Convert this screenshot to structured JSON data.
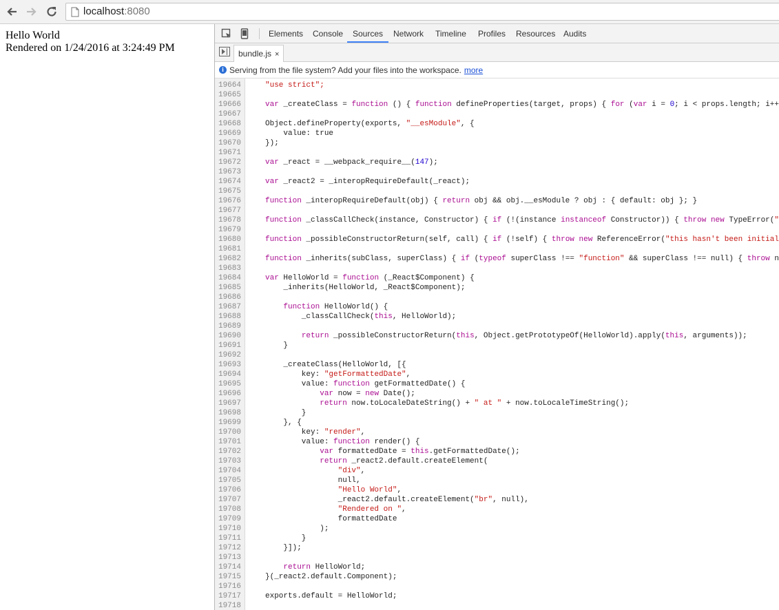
{
  "browser": {
    "url_host": "localhost",
    "url_port": ":8080"
  },
  "page": {
    "line1": "Hello World",
    "line2": "Rendered on 1/24/2016 at 3:24:49 PM"
  },
  "devtools": {
    "tabs": [
      "Elements",
      "Console",
      "Sources",
      "Network",
      "Timeline",
      "Profiles",
      "Resources",
      "Audits"
    ],
    "active_tab": "Sources",
    "file_tab": "bundle.js",
    "file_tab_close": "×",
    "info_icon": "i",
    "info_message": "Serving from the file system? Add your files into the workspace.",
    "info_link": "more"
  },
  "code_lines": [
    {
      "n": "19664",
      "t": [
        [
          "\"use strict\";",
          "str"
        ]
      ]
    },
    {
      "n": "19665",
      "t": []
    },
    {
      "n": "19666",
      "t": [
        [
          "var",
          "kw"
        ],
        [
          " _createClass = ",
          ""
        ],
        [
          "function",
          "kw"
        ],
        [
          " () { ",
          ""
        ],
        [
          "function",
          "kw"
        ],
        [
          " defineProperties(target, props) { ",
          ""
        ],
        [
          "for",
          "kw"
        ],
        [
          " (",
          ""
        ],
        [
          "var",
          "kw"
        ],
        [
          " i = ",
          ""
        ],
        [
          "0",
          "num"
        ],
        [
          "; i < props.length; i++",
          ""
        ]
      ]
    },
    {
      "n": "19667",
      "t": []
    },
    {
      "n": "19668",
      "t": [
        [
          "Object.defineProperty(exports, ",
          ""
        ],
        [
          "\"__esModule\"",
          "str"
        ],
        [
          ", {",
          ""
        ]
      ]
    },
    {
      "n": "19669",
      "t": [
        [
          "    value: true",
          ""
        ]
      ]
    },
    {
      "n": "19670",
      "t": [
        [
          "});",
          ""
        ]
      ]
    },
    {
      "n": "19671",
      "t": []
    },
    {
      "n": "19672",
      "t": [
        [
          "var",
          "kw"
        ],
        [
          " _react = __webpack_require__(",
          ""
        ],
        [
          "147",
          "num"
        ],
        [
          ");",
          ""
        ]
      ]
    },
    {
      "n": "19673",
      "t": []
    },
    {
      "n": "19674",
      "t": [
        [
          "var",
          "kw"
        ],
        [
          " _react2 = _interopRequireDefault(_react);",
          ""
        ]
      ]
    },
    {
      "n": "19675",
      "t": []
    },
    {
      "n": "19676",
      "t": [
        [
          "function",
          "kw"
        ],
        [
          " _interopRequireDefault(obj) { ",
          ""
        ],
        [
          "return",
          "kw"
        ],
        [
          " obj && obj.__esModule ? obj : { default: obj }; }",
          ""
        ]
      ]
    },
    {
      "n": "19677",
      "t": []
    },
    {
      "n": "19678",
      "t": [
        [
          "function",
          "kw"
        ],
        [
          " _classCallCheck(instance, Constructor) { ",
          ""
        ],
        [
          "if",
          "kw"
        ],
        [
          " (!(instance ",
          ""
        ],
        [
          "instanceof",
          "kw"
        ],
        [
          " Constructor)) { ",
          ""
        ],
        [
          "throw",
          "kw"
        ],
        [
          " ",
          ""
        ],
        [
          "new",
          "kw"
        ],
        [
          " TypeError(",
          ""
        ],
        [
          "\"C",
          "str"
        ]
      ]
    },
    {
      "n": "19679",
      "t": []
    },
    {
      "n": "19680",
      "t": [
        [
          "function",
          "kw"
        ],
        [
          " _possibleConstructorReturn(self, call) { ",
          ""
        ],
        [
          "if",
          "kw"
        ],
        [
          " (!self) { ",
          ""
        ],
        [
          "throw",
          "kw"
        ],
        [
          " ",
          ""
        ],
        [
          "new",
          "kw"
        ],
        [
          " ReferenceError(",
          ""
        ],
        [
          "\"this hasn't been initial",
          "str"
        ]
      ]
    },
    {
      "n": "19681",
      "t": []
    },
    {
      "n": "19682",
      "t": [
        [
          "function",
          "kw"
        ],
        [
          " _inherits(subClass, superClass) { ",
          ""
        ],
        [
          "if",
          "kw"
        ],
        [
          " (",
          ""
        ],
        [
          "typeof",
          "kw"
        ],
        [
          " superClass !== ",
          ""
        ],
        [
          "\"function\"",
          "str"
        ],
        [
          " && superClass !== null) { ",
          ""
        ],
        [
          "throw",
          "kw"
        ],
        [
          " ne",
          ""
        ]
      ]
    },
    {
      "n": "19683",
      "t": []
    },
    {
      "n": "19684",
      "t": [
        [
          "var",
          "kw"
        ],
        [
          " HelloWorld = ",
          ""
        ],
        [
          "function",
          "kw"
        ],
        [
          " (_React$Component) {",
          ""
        ]
      ]
    },
    {
      "n": "19685",
      "t": [
        [
          "    _inherits(HelloWorld, _React$Component);",
          ""
        ]
      ]
    },
    {
      "n": "19686",
      "t": []
    },
    {
      "n": "19687",
      "t": [
        [
          "    ",
          ""
        ],
        [
          "function",
          "kw"
        ],
        [
          " HelloWorld() {",
          ""
        ]
      ]
    },
    {
      "n": "19688",
      "t": [
        [
          "        _classCallCheck(",
          ""
        ],
        [
          "this",
          "kw"
        ],
        [
          ", HelloWorld);",
          ""
        ]
      ]
    },
    {
      "n": "19689",
      "t": []
    },
    {
      "n": "19690",
      "t": [
        [
          "        ",
          ""
        ],
        [
          "return",
          "kw"
        ],
        [
          " _possibleConstructorReturn(",
          ""
        ],
        [
          "this",
          "kw"
        ],
        [
          ", Object.getPrototypeOf(HelloWorld).apply(",
          ""
        ],
        [
          "this",
          "kw"
        ],
        [
          ", arguments));",
          ""
        ]
      ]
    },
    {
      "n": "19691",
      "t": [
        [
          "    }",
          ""
        ]
      ]
    },
    {
      "n": "19692",
      "t": []
    },
    {
      "n": "19693",
      "t": [
        [
          "    _createClass(HelloWorld, [{",
          ""
        ]
      ]
    },
    {
      "n": "19694",
      "t": [
        [
          "        key: ",
          ""
        ],
        [
          "\"getFormattedDate\"",
          "str"
        ],
        [
          ",",
          ""
        ]
      ]
    },
    {
      "n": "19695",
      "t": [
        [
          "        value: ",
          ""
        ],
        [
          "function",
          "kw"
        ],
        [
          " getFormattedDate() {",
          ""
        ]
      ]
    },
    {
      "n": "19696",
      "t": [
        [
          "            ",
          ""
        ],
        [
          "var",
          "kw"
        ],
        [
          " now = ",
          ""
        ],
        [
          "new",
          "kw"
        ],
        [
          " Date();",
          ""
        ]
      ]
    },
    {
      "n": "19697",
      "t": [
        [
          "            ",
          ""
        ],
        [
          "return",
          "kw"
        ],
        [
          " now.toLocaleDateString() + ",
          ""
        ],
        [
          "\" at \"",
          "str"
        ],
        [
          " + now.toLocaleTimeString();",
          ""
        ]
      ]
    },
    {
      "n": "19698",
      "t": [
        [
          "        }",
          ""
        ]
      ]
    },
    {
      "n": "19699",
      "t": [
        [
          "    }, {",
          ""
        ]
      ]
    },
    {
      "n": "19700",
      "t": [
        [
          "        key: ",
          ""
        ],
        [
          "\"render\"",
          "str"
        ],
        [
          ",",
          ""
        ]
      ]
    },
    {
      "n": "19701",
      "t": [
        [
          "        value: ",
          ""
        ],
        [
          "function",
          "kw"
        ],
        [
          " render() {",
          ""
        ]
      ]
    },
    {
      "n": "19702",
      "t": [
        [
          "            ",
          ""
        ],
        [
          "var",
          "kw"
        ],
        [
          " formattedDate = ",
          ""
        ],
        [
          "this",
          "kw"
        ],
        [
          ".getFormattedDate();",
          ""
        ]
      ]
    },
    {
      "n": "19703",
      "t": [
        [
          "            ",
          ""
        ],
        [
          "return",
          "kw"
        ],
        [
          " _react2.default.createElement(",
          ""
        ]
      ]
    },
    {
      "n": "19704",
      "t": [
        [
          "                ",
          ""
        ],
        [
          "\"div\"",
          "str"
        ],
        [
          ",",
          ""
        ]
      ]
    },
    {
      "n": "19705",
      "t": [
        [
          "                null,",
          ""
        ]
      ]
    },
    {
      "n": "19706",
      "t": [
        [
          "                ",
          ""
        ],
        [
          "\"Hello World\"",
          "str"
        ],
        [
          ",",
          ""
        ]
      ]
    },
    {
      "n": "19707",
      "t": [
        [
          "                _react2.default.createElement(",
          ""
        ],
        [
          "\"br\"",
          "str"
        ],
        [
          ", null),",
          ""
        ]
      ]
    },
    {
      "n": "19708",
      "t": [
        [
          "                ",
          ""
        ],
        [
          "\"Rendered on \"",
          "str"
        ],
        [
          ",",
          ""
        ]
      ]
    },
    {
      "n": "19709",
      "t": [
        [
          "                formattedDate",
          ""
        ]
      ]
    },
    {
      "n": "19710",
      "t": [
        [
          "            );",
          ""
        ]
      ]
    },
    {
      "n": "19711",
      "t": [
        [
          "        }",
          ""
        ]
      ]
    },
    {
      "n": "19712",
      "t": [
        [
          "    }]);",
          ""
        ]
      ]
    },
    {
      "n": "19713",
      "t": []
    },
    {
      "n": "19714",
      "t": [
        [
          "    ",
          ""
        ],
        [
          "return",
          "kw"
        ],
        [
          " HelloWorld;",
          ""
        ]
      ]
    },
    {
      "n": "19715",
      "t": [
        [
          "}(_react2.default.Component);",
          ""
        ]
      ]
    },
    {
      "n": "19716",
      "t": []
    },
    {
      "n": "19717",
      "t": [
        [
          "exports.default = HelloWorld;",
          ""
        ]
      ]
    },
    {
      "n": "19718",
      "t": []
    }
  ]
}
